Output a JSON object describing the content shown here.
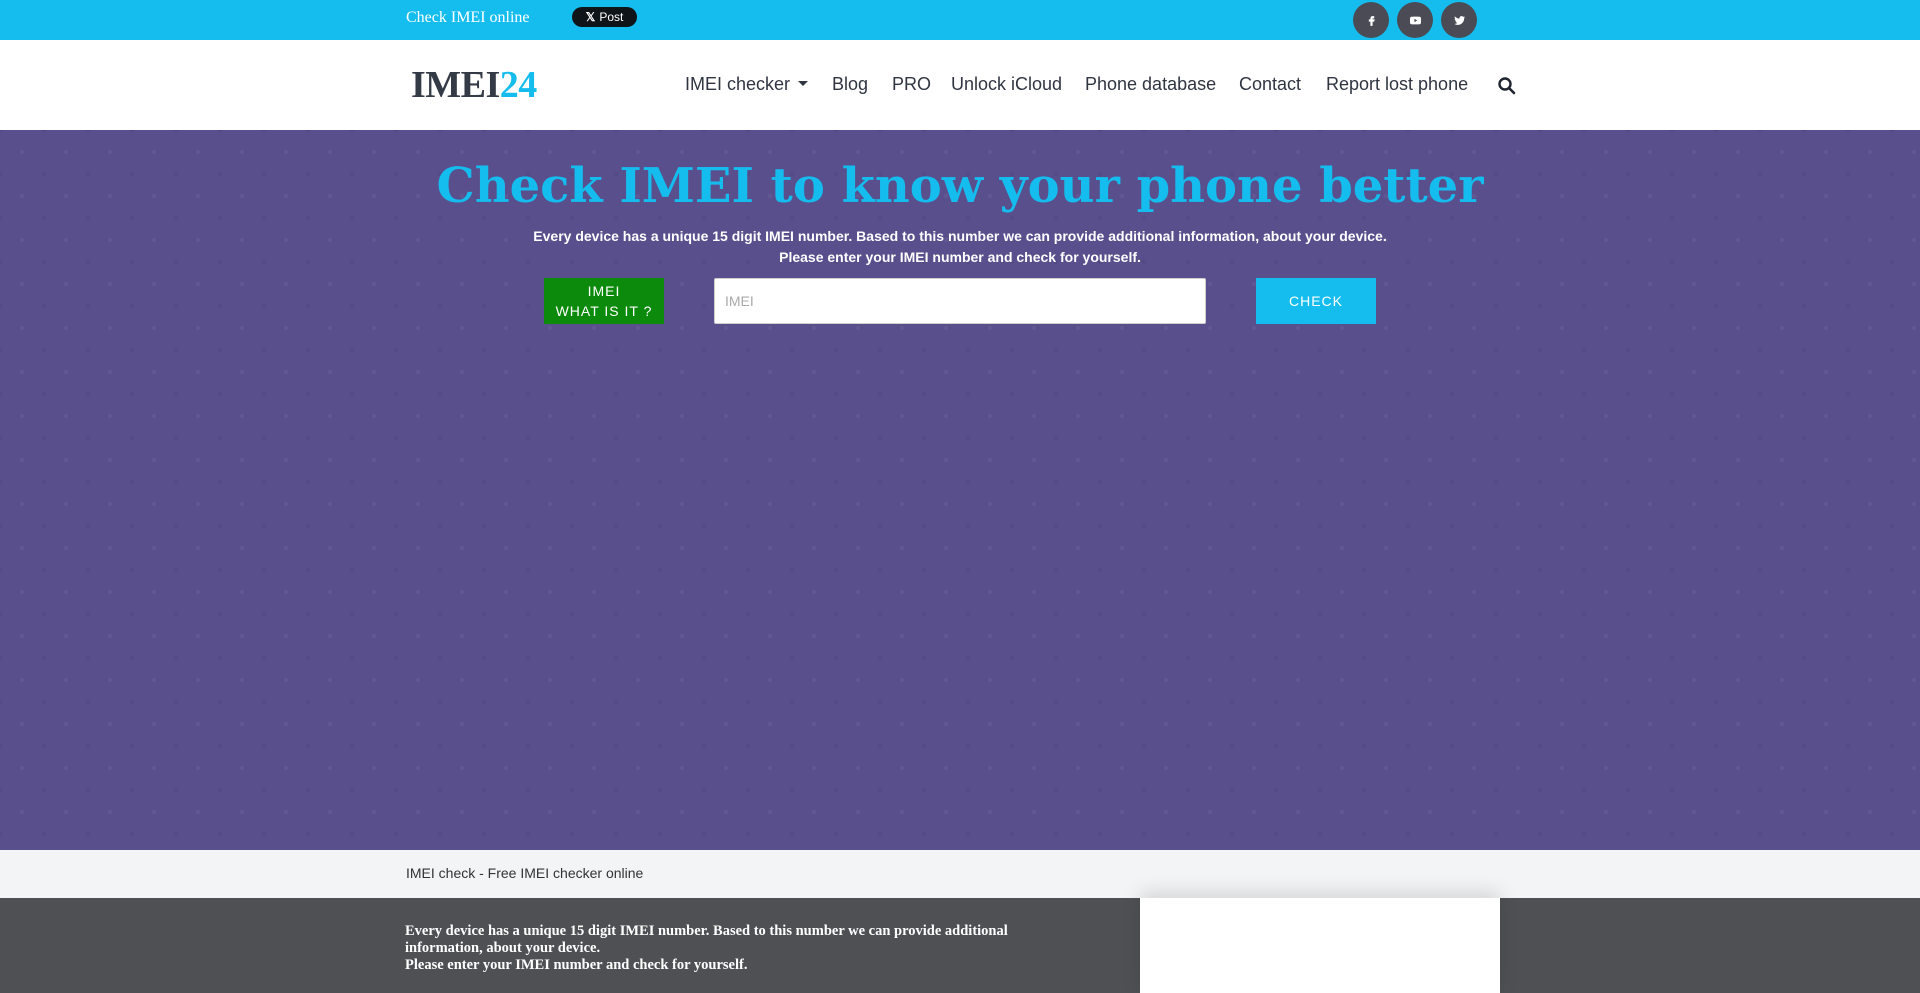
{
  "topbar": {
    "tagline": "Check IMEI online",
    "x_post_label": "Post",
    "x_post_logo": "𝕏",
    "social": [
      "facebook-icon",
      "youtube-icon",
      "twitter-icon"
    ]
  },
  "header": {
    "logo_part1": "IMEI",
    "logo_part2": "24",
    "nav": {
      "imei_checker": "IMEI checker",
      "blog": "Blog",
      "pro": "PRO",
      "unlock_icloud": "Unlock iCloud",
      "phone_database": "Phone database",
      "contact": "Contact",
      "report_lost_phone": "Report lost phone"
    }
  },
  "hero": {
    "title": "Check IMEI to know your phone better",
    "subtitle_line1": "Every device has a unique 15 digit IMEI number. Based to this number we can provide additional information, about your device.",
    "subtitle_line2": "Please enter your IMEI number and check for yourself.",
    "what_button_line1": "IMEI",
    "what_button_line2": "WHAT IS IT ?",
    "input_placeholder": "IMEI",
    "input_value": "",
    "check_button": "CHECK"
  },
  "breadcrumb": {
    "text": "IMEI check - Free IMEI checker online"
  },
  "bottom": {
    "line1": "Every device has a unique 15 digit IMEI number. Based to this number we can provide additional information, about your device.",
    "line2": "Please enter your IMEI number and check for yourself."
  },
  "colors": {
    "accent": "#15bcee",
    "hero_bg": "#594f8d",
    "what_button": "#0c8a0c",
    "dark_footer": "#4f5054"
  }
}
